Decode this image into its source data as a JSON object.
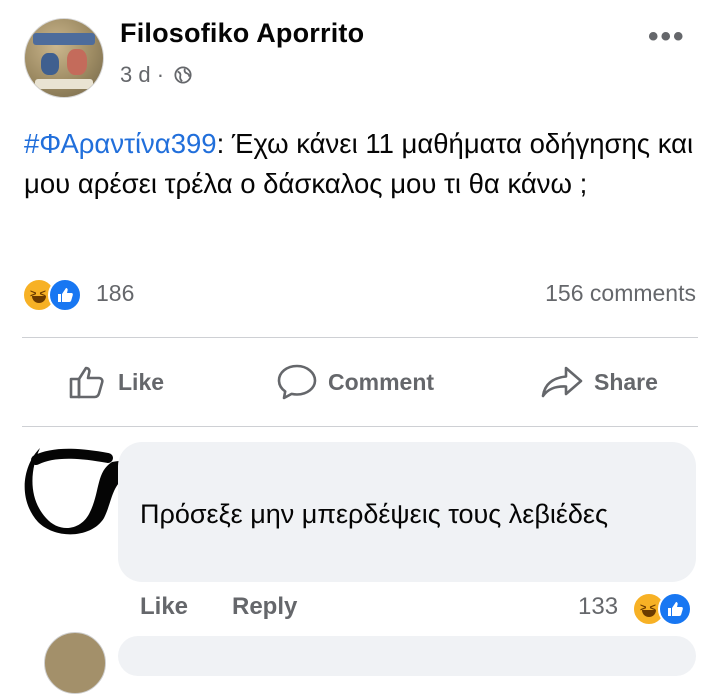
{
  "post": {
    "page_name": "Filosofiko Aporrito",
    "time": "3 d",
    "separator": "·",
    "privacy_icon": "globe-icon",
    "more_icon": "more-dots-icon",
    "hashtag": "#ΦΑραντίνα399",
    "body": ": Έχω κάνει 11 μαθήματα οδήγησης και μου αρέσει τρέλα ο δάσκαλος μου τι θα κάνω ;",
    "reaction_icons": [
      "haha-reaction-icon",
      "like-reaction-icon"
    ],
    "reaction_count": "186",
    "comment_count": "156 comments"
  },
  "actions": {
    "like": "Like",
    "comment": "Comment",
    "share": "Share"
  },
  "comment": {
    "text": "Πρόσεξε μην μπερδέψεις τους λεβιέδες",
    "like": "Like",
    "reply": "Reply",
    "reaction_count": "133"
  },
  "colors": {
    "hashtag": "#216fdb",
    "like_blue": "#1877f2",
    "haha_yellow": "#f7b125",
    "muted_text": "#65676b",
    "bubble_bg": "#f0f2f5"
  }
}
